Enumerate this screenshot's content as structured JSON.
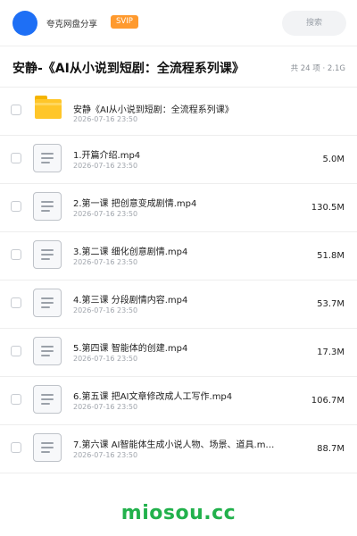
{
  "header": {
    "brand": "夸克网盘分享",
    "badge": "SVIP",
    "search_placeholder": "搜索"
  },
  "folder": {
    "title": "安静-《AI从小说到短剧：全流程系列课》",
    "meta": "共 24 项 · 2.1G"
  },
  "items": [
    {
      "type": "folder",
      "name": "安静《AI从小说到短剧：全流程系列课》",
      "date": "2026-07-16 23:50",
      "size": ""
    },
    {
      "type": "file",
      "name": "1.开篇介绍.mp4",
      "date": "2026-07-16 23:50",
      "size": "5.0M"
    },
    {
      "type": "file",
      "name": "2.第一课 把创意变成剧情.mp4",
      "date": "2026-07-16 23:50",
      "size": "130.5M"
    },
    {
      "type": "file",
      "name": "3.第二课 细化创意剧情.mp4",
      "date": "2026-07-16 23:50",
      "size": "51.8M"
    },
    {
      "type": "file",
      "name": "4.第三课 分段剧情内容.mp4",
      "date": "2026-07-16 23:50",
      "size": "53.7M"
    },
    {
      "type": "file",
      "name": "5.第四课 智能体的创建.mp4",
      "date": "2026-07-16 23:50",
      "size": "17.3M"
    },
    {
      "type": "file",
      "name": "6.第五课 把AI文章修改成人工写作.mp4",
      "date": "2026-07-16 23:50",
      "size": "106.7M"
    },
    {
      "type": "file",
      "name": "7.第六课 AI智能体生成小说人物、场景、道具.m…",
      "date": "2026-07-16 23:50",
      "size": "88.7M"
    }
  ],
  "watermark": "miosou.cc",
  "colors": {
    "accent": "#1e6ff5",
    "badge": "#ff9a2e",
    "folder": "#ffc629",
    "watermark": "#22b14c"
  },
  "icons": {
    "folder": "folder-icon",
    "file": "video-file-icon"
  }
}
